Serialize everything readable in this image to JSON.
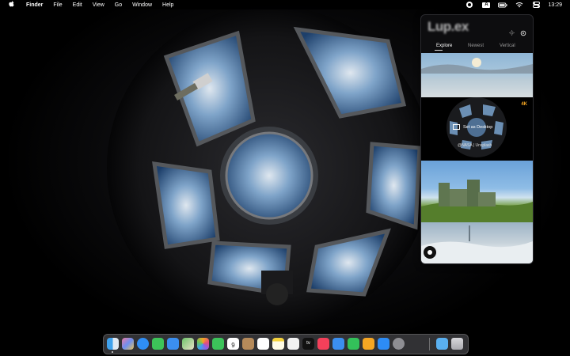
{
  "menubar": {
    "apple_icon": "apple-logo-icon",
    "app_name": "Finder",
    "menus": [
      "File",
      "Edit",
      "View",
      "Go",
      "Window",
      "Help"
    ],
    "status_icons": [
      "app-status-icon",
      "input-source-icon",
      "battery-icon",
      "wifi-icon",
      "control-center-icon"
    ],
    "input_source_label": "A",
    "clock": "13:29"
  },
  "panel": {
    "logo": "Lup.ex",
    "tabs": [
      "Explore",
      "Newest",
      "Vertical"
    ],
    "active_tab": "Explore",
    "badge": "4K",
    "set_desktop_label": "Set as Desktop",
    "credit": "@NASA | Unsplash"
  },
  "dock": {
    "apps": [
      "Finder",
      "Launchpad",
      "Safari",
      "Messages",
      "Mail",
      "Maps",
      "Photos",
      "FaceTime",
      "Calendar",
      "Contacts",
      "Reminders",
      "Notes",
      "TV",
      "Music",
      "Podcasts",
      "Numbers",
      "Pages",
      "App Store",
      "System Settings",
      "Downloads",
      "Trash"
    ],
    "calendar_day": "9",
    "tv_label": "tv"
  }
}
